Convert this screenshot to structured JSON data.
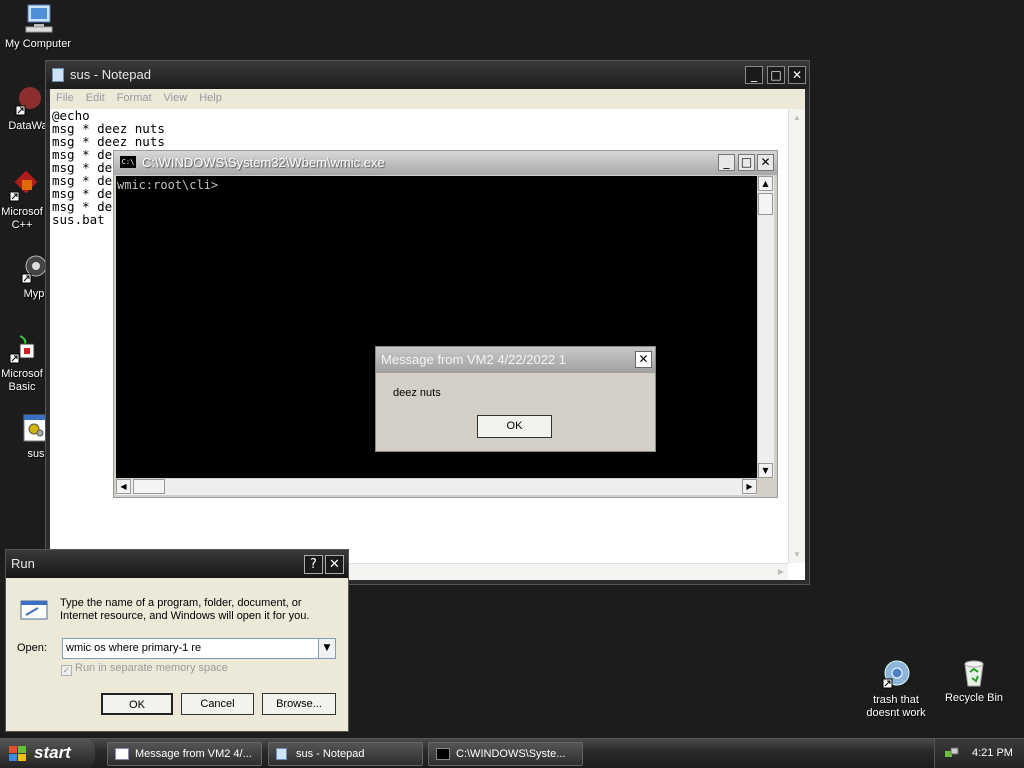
{
  "desktop": {
    "icons": [
      {
        "label": "My Computer"
      },
      {
        "label": "DataWa"
      },
      {
        "label": "Microsof\nC++"
      },
      {
        "label": "Myp"
      },
      {
        "label": "Microsof\nBasic"
      },
      {
        "label": "sus"
      },
      {
        "label": "trash that\ndoesnt work"
      },
      {
        "label": "Recycle Bin"
      }
    ]
  },
  "notepad": {
    "title": "sus - Notepad",
    "menu": [
      "File",
      "Edit",
      "Format",
      "View",
      "Help"
    ],
    "text": "@echo\nmsg * deez nuts\nmsg * deez nuts\nmsg * de\nmsg * de\nmsg * de\nmsg * de\nmsg * de\nsus.bat"
  },
  "console": {
    "title": "C:\\WINDOWS\\System32\\Wbem\\wmic.exe",
    "output": "wmic:root\\cli>",
    "icon": "C:\\"
  },
  "messagebox": {
    "title": "Message from VM2 4/22/2022 1",
    "message": "deez nuts",
    "ok_label": "OK"
  },
  "run_dialog": {
    "title": "Run",
    "help_label": "?",
    "description": "Type the name of a program, folder, document, or Internet resource, and Windows will open it for you.",
    "open_label": "Open:",
    "open_value": "wmic os where primary-1 re",
    "checkbox_label": "Run in separate memory space",
    "checkbox_checked": true,
    "ok_label": "OK",
    "cancel_label": "Cancel",
    "browse_label": "Browse..."
  },
  "taskbar": {
    "start_label": "start",
    "tasks": [
      {
        "label": "Message from VM2 4/..."
      },
      {
        "label": "sus - Notepad"
      },
      {
        "label": "C:\\WINDOWS\\Syste..."
      }
    ],
    "clock": "4:21 PM"
  }
}
